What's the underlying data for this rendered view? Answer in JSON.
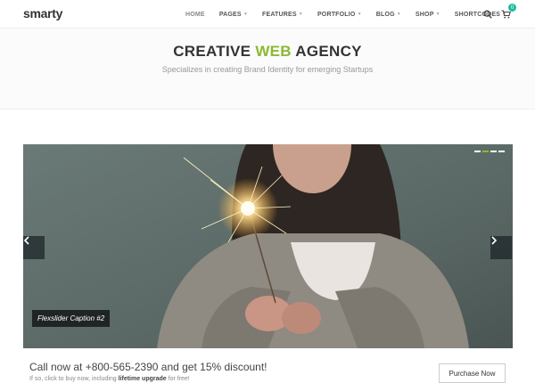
{
  "header": {
    "logo": "smarty",
    "nav": [
      {
        "label": "HOME",
        "active": true,
        "has_caret": false
      },
      {
        "label": "PAGES",
        "has_caret": true
      },
      {
        "label": "FEATURES",
        "has_caret": true
      },
      {
        "label": "PORTFOLIO",
        "has_caret": true
      },
      {
        "label": "BLOG",
        "has_caret": true
      },
      {
        "label": "SHOP",
        "has_caret": true
      },
      {
        "label": "SHORTCODES",
        "has_caret": true
      }
    ],
    "icons": [
      "search-icon",
      "cart-icon"
    ],
    "cart_count": "0"
  },
  "hero": {
    "title_before": "CREATIVE ",
    "title_accent": "WEB",
    "title_after": " AGENCY",
    "subtitle": "Specializes in creating Brand Identity for emerging Startups",
    "accent_color": "#8ab933"
  },
  "slider": {
    "caption": "Flexslider Caption #2",
    "slide_count": 4,
    "active_slide": 2
  },
  "cta": {
    "text": "Call now at +800-565-2390 and get 15% discount!",
    "sub_before": "If so, click to buy now, including ",
    "sub_bold": "lifetime upgrade",
    "sub_after": " for free!",
    "button_label": "Purchase Now"
  }
}
